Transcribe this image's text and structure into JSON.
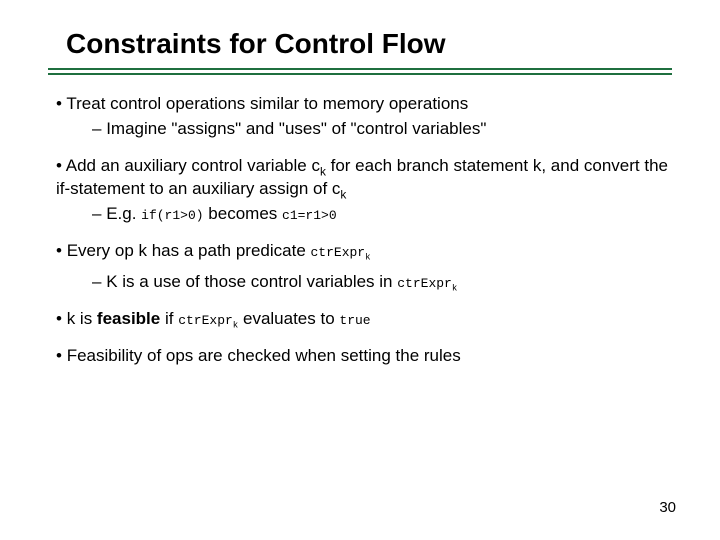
{
  "slide": {
    "title": "Constraints for Control Flow",
    "page_number": "30",
    "b1": "Treat control operations similar to memory operations",
    "b1s1": "Imagine \"assigns\" and \"uses\" of \"control variables\"",
    "b2a": "Add an auxiliary control variable ",
    "b2b": " for each branch statement ",
    "b2c": ", and convert the if-statement to an auxiliary assign of ",
    "ck_c": "c",
    "ck_k": "k",
    "k_var": "k",
    "b2s1a": "E.g. ",
    "b2s1_code1": "if(r1>0)",
    "b2s1b": " becomes ",
    "b2s1_code2": "c1=r1>0",
    "b3a": "Every op k has a path predicate ",
    "ctrexpr": "ctrExpr",
    "b3s1a": "K is a use of those control variables in ",
    "b4a": "k is ",
    "b4b": "feasible",
    "b4c": " if ",
    "b4d": " evaluates to ",
    "true_code": "true",
    "b5": "Feasibility of ops are checked when setting the rules"
  }
}
